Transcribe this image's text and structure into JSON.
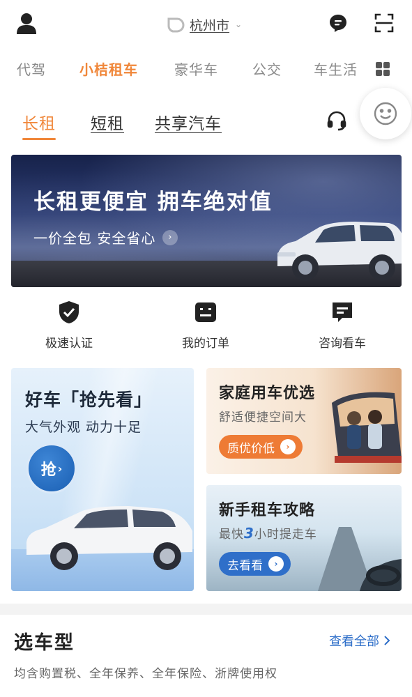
{
  "header": {
    "city": "杭州市",
    "icons": {
      "user": "user-icon",
      "message": "chat-bubble-icon",
      "scan": "scan-icon",
      "logo": "didi-logo-icon"
    }
  },
  "main_nav": {
    "items": [
      {
        "label": "代驾",
        "active": false
      },
      {
        "label": "小桔租车",
        "active": true
      },
      {
        "label": "豪华车",
        "active": false
      },
      {
        "label": "公交",
        "active": false
      },
      {
        "label": "车生活",
        "active": false
      }
    ]
  },
  "sub_tabs": {
    "items": [
      {
        "label": "长租",
        "active": true
      },
      {
        "label": "短租",
        "active": false
      },
      {
        "label": "共享汽车",
        "active": false
      }
    ]
  },
  "banner": {
    "title": "长租更便宜 拥车绝对值",
    "subtitle": "一价全包 安全省心"
  },
  "quick_actions": [
    {
      "label": "极速认证",
      "icon": "shield-check-icon"
    },
    {
      "label": "我的订单",
      "icon": "order-list-icon"
    },
    {
      "label": "咨询看车",
      "icon": "chat-bubble-icon"
    }
  ],
  "promo_big": {
    "title": "好车「抢先看」",
    "subtitle": "大气外观  动力十足",
    "button": "抢"
  },
  "promo_family": {
    "title": "家庭用车优选",
    "subtitle": "舒适便捷空间大",
    "button": "质优价低"
  },
  "promo_new": {
    "title": "新手租车攻略",
    "subtitle_prefix": "最快",
    "subtitle_highlight": "3",
    "subtitle_suffix": "小时提走车",
    "button": "去看看"
  },
  "section": {
    "title": "选车型",
    "link": "查看全部",
    "description": "均含购置税、全年保养、全年保险、浙牌使用权"
  },
  "colors": {
    "accent": "#f0873a",
    "link": "#2f6fc9"
  }
}
